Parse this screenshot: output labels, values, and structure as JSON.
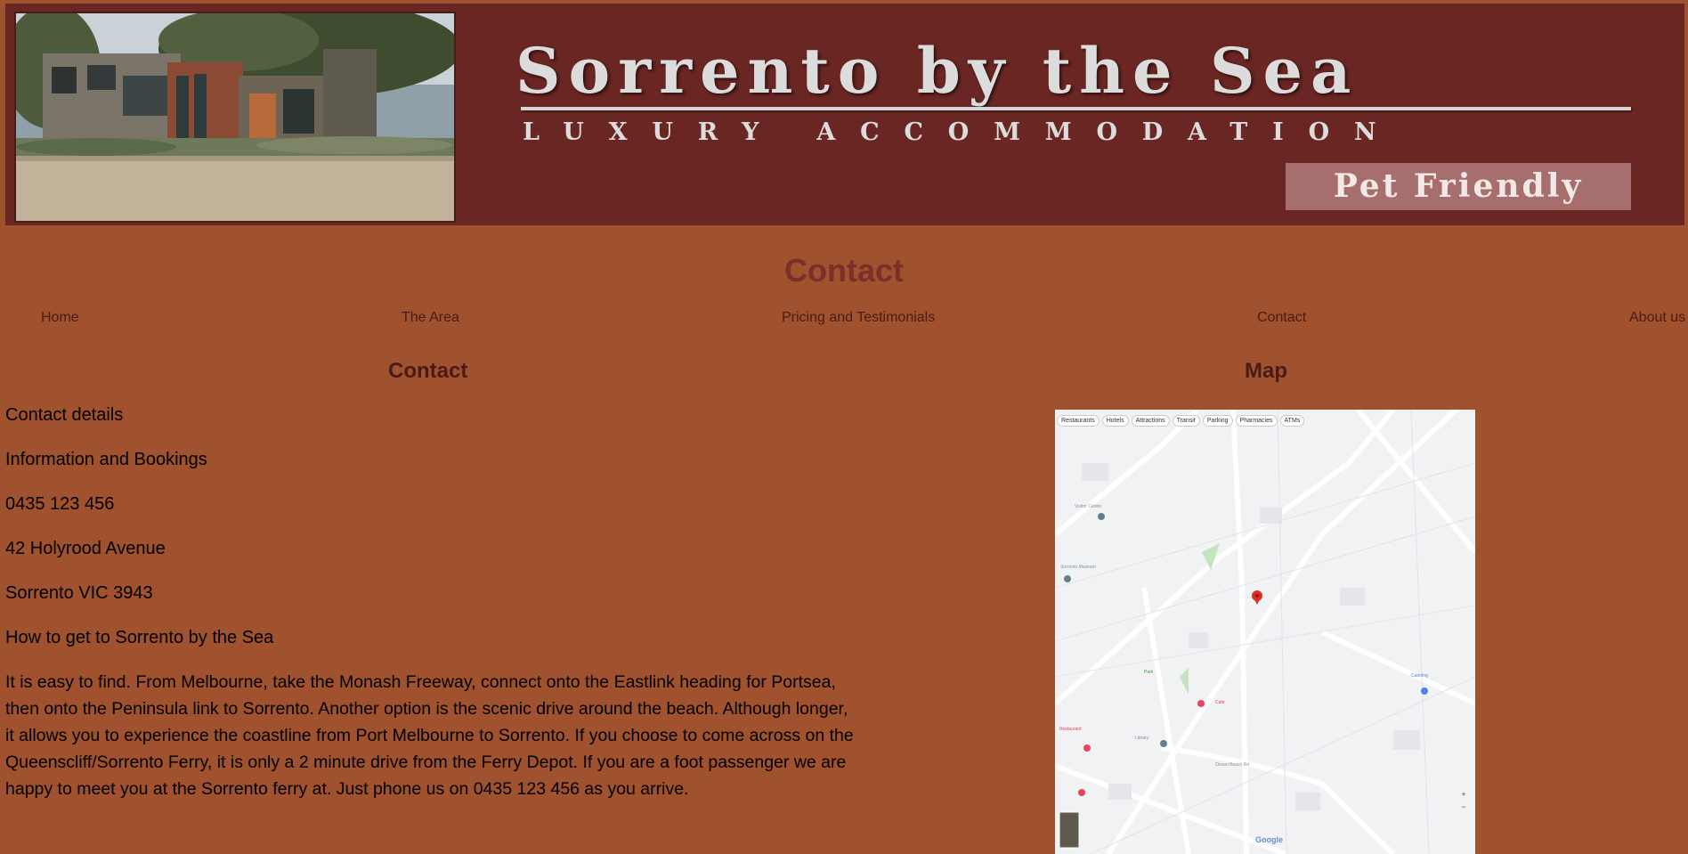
{
  "header": {
    "title": "Sorrento by the Sea",
    "subtitle": "LUXURY ACCOMMODATION",
    "badge": "Pet Friendly"
  },
  "page": {
    "title": "Contact"
  },
  "nav": {
    "items": [
      {
        "label": "Home"
      },
      {
        "label": "The Area"
      },
      {
        "label": "Pricing and Testimonials"
      },
      {
        "label": "Contact"
      },
      {
        "label": "About us"
      }
    ]
  },
  "contact": {
    "heading": "Contact",
    "lines": [
      "Contact details",
      "Information and Bookings",
      "0435 123 456",
      "42 Holyrood Avenue",
      "Sorrento VIC 3943",
      "How to get to Sorrento by the Sea"
    ],
    "directions": "It is easy to find. From Melbourne, take the Monash Freeway, connect onto the Eastlink heading for Portsea, then onto the Peninsula link to Sorrento. Another option is the scenic drive around the beach. Although longer, it allows you to experience the coastline from Port Melbourne to Sorrento. If you choose to come across on the Queenscliff/Sorrento Ferry, it is only a 2 minute drive from the Ferry Depot. If you are a foot passenger we are happy to meet you at the Sorrento ferry at. Just phone us on 0435 123 456 as you arrive."
  },
  "map": {
    "heading": "Map",
    "chips": [
      "Restaurants",
      "Hotels",
      "Attractions",
      "Transit",
      "Parking",
      "Pharmacies",
      "ATMs"
    ],
    "logo": "Google"
  },
  "colors": {
    "page_background": "#a0512d",
    "banner_background": "#692623",
    "title_color": "#7a3029",
    "nav_color": "#4a1a15"
  }
}
